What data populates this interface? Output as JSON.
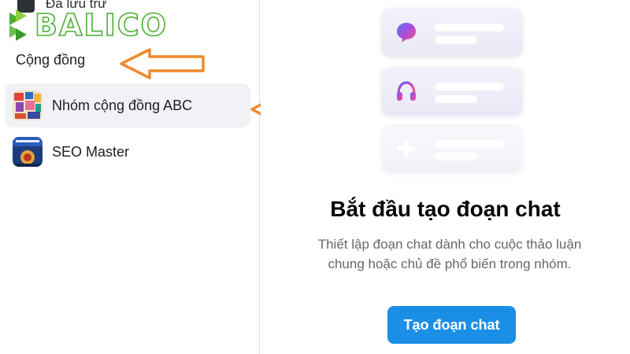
{
  "sidebar": {
    "archived_label": "Đã lưu trữ",
    "section_title": "Cộng đồng",
    "groups": [
      {
        "name": "Nhóm cộng đồng ABC"
      },
      {
        "name": "SEO Master"
      }
    ]
  },
  "brand": {
    "logo_text": "BALICO"
  },
  "main": {
    "cards": [
      {
        "icon": "chat-bubble-icon"
      },
      {
        "icon": "headphones-icon"
      },
      {
        "icon": "plus-icon"
      }
    ],
    "title": "Bắt đầu tạo đoạn chat",
    "description": "Thiết lập đoạn chat dành cho cuộc thảo luận chung hoặc chủ đề phổ biến trong nhóm.",
    "create_button": "Tạo đoạn chat"
  },
  "colors": {
    "accent": "#1b8fe6",
    "annotation_arrow": "#f08a2c",
    "logo": "#4caf35"
  }
}
